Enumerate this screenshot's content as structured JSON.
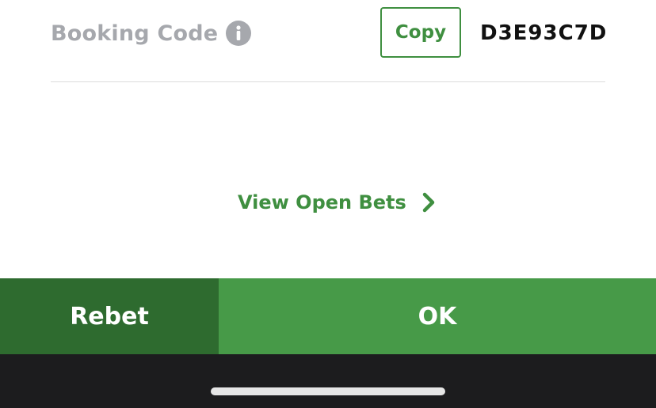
{
  "booking": {
    "label": "Booking Code",
    "info_icon": "info-icon",
    "copy_label": "Copy",
    "code": "D3E93C7D"
  },
  "links": {
    "view_open_bets": "View Open Bets",
    "chevron_icon": "chevron-right-icon"
  },
  "actions": {
    "rebet_label": "Rebet",
    "ok_label": "OK"
  },
  "colors": {
    "accent_green": "#3f8f40",
    "ok_green": "#479a48",
    "rebet_green": "#2e6b2f",
    "label_gray": "#a6a8ad",
    "home_bar_bg": "#1c1c1e"
  }
}
